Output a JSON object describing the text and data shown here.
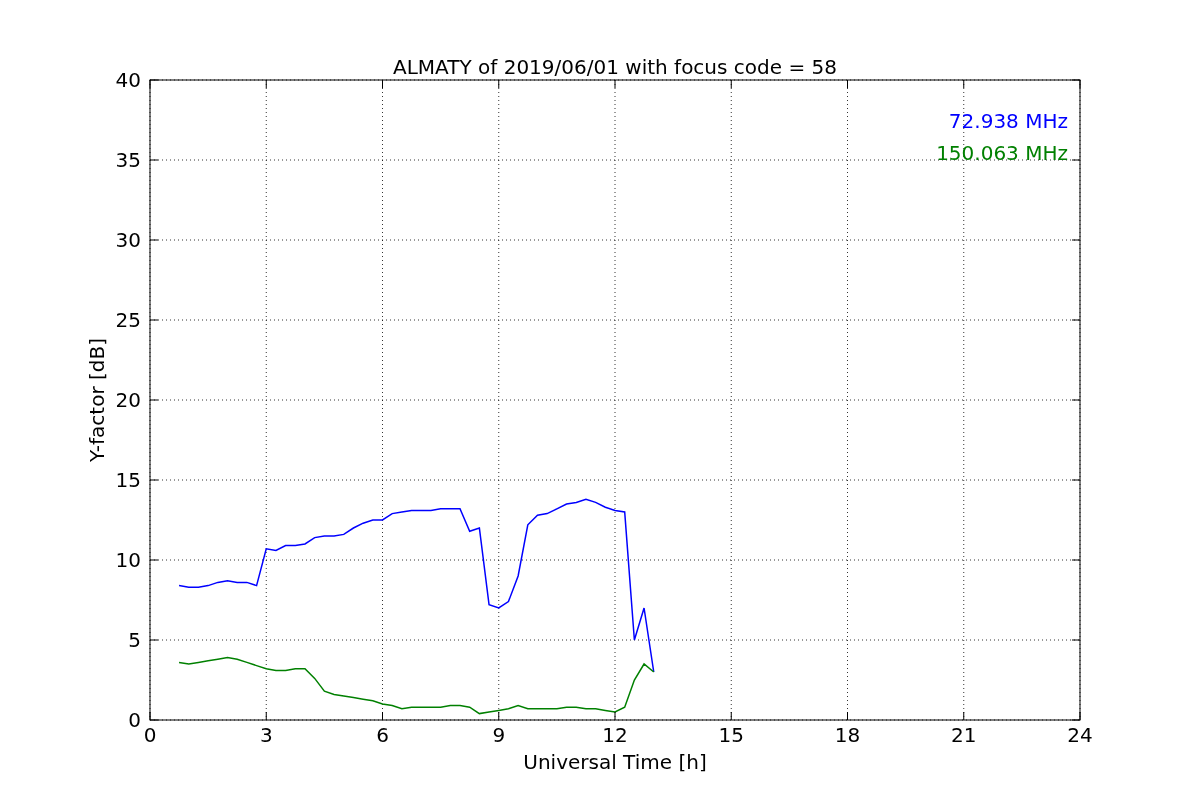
{
  "figure": {
    "chart_data": {
      "type": "line",
      "title": "ALMATY of 2019/06/01 with focus code = 58",
      "xlabel": "Universal Time [h]",
      "ylabel": "Y-factor [dB]",
      "x": [
        0.75,
        1.0,
        1.25,
        1.5,
        1.75,
        2.0,
        2.25,
        2.5,
        2.75,
        3.0,
        3.25,
        3.5,
        3.75,
        4.0,
        4.25,
        4.5,
        4.75,
        5.0,
        5.25,
        5.5,
        5.75,
        6.0,
        6.25,
        6.5,
        6.75,
        7.0,
        7.25,
        7.5,
        7.75,
        8.0,
        8.25,
        8.5,
        8.75,
        9.0,
        9.25,
        9.5,
        9.75,
        10.0,
        10.25,
        10.5,
        10.75,
        11.0,
        11.25,
        11.5,
        11.75,
        12.0,
        12.25,
        12.5,
        12.75,
        13.0
      ],
      "series": [
        {
          "name": "72.938 MHz",
          "color": "#0000ff",
          "values": [
            8.4,
            8.3,
            8.3,
            8.4,
            8.6,
            8.7,
            8.6,
            8.6,
            8.4,
            10.7,
            10.6,
            10.9,
            10.9,
            11.0,
            11.4,
            11.5,
            11.5,
            11.6,
            12.0,
            12.3,
            12.5,
            12.5,
            12.9,
            13.0,
            13.1,
            13.1,
            13.1,
            13.2,
            13.2,
            13.2,
            11.8,
            12.0,
            7.2,
            7.0,
            7.4,
            9.0,
            12.2,
            12.8,
            12.9,
            13.2,
            13.5,
            13.6,
            13.8,
            13.6,
            13.3,
            13.1,
            13.0,
            5.0,
            7.0,
            3.0
          ]
        },
        {
          "name": "150.063 MHz",
          "color": "#008000",
          "values": [
            3.6,
            3.5,
            3.6,
            3.7,
            3.8,
            3.9,
            3.8,
            3.6,
            3.4,
            3.2,
            3.1,
            3.1,
            3.2,
            3.2,
            2.6,
            1.8,
            1.6,
            1.5,
            1.4,
            1.3,
            1.2,
            1.0,
            0.9,
            0.7,
            0.8,
            0.8,
            0.8,
            0.8,
            0.9,
            0.9,
            0.8,
            0.4,
            0.5,
            0.6,
            0.7,
            0.9,
            0.7,
            0.7,
            0.7,
            0.7,
            0.8,
            0.8,
            0.7,
            0.7,
            0.6,
            0.5,
            0.8,
            2.5,
            3.5,
            3.0
          ]
        }
      ],
      "grid": true,
      "xlim": [
        0,
        24
      ],
      "ylim": [
        0,
        40
      ],
      "xticks": [
        0,
        3,
        6,
        9,
        12,
        15,
        18,
        21,
        24
      ],
      "yticks": [
        0,
        5,
        10,
        15,
        20,
        25,
        30,
        35,
        40
      ]
    }
  }
}
